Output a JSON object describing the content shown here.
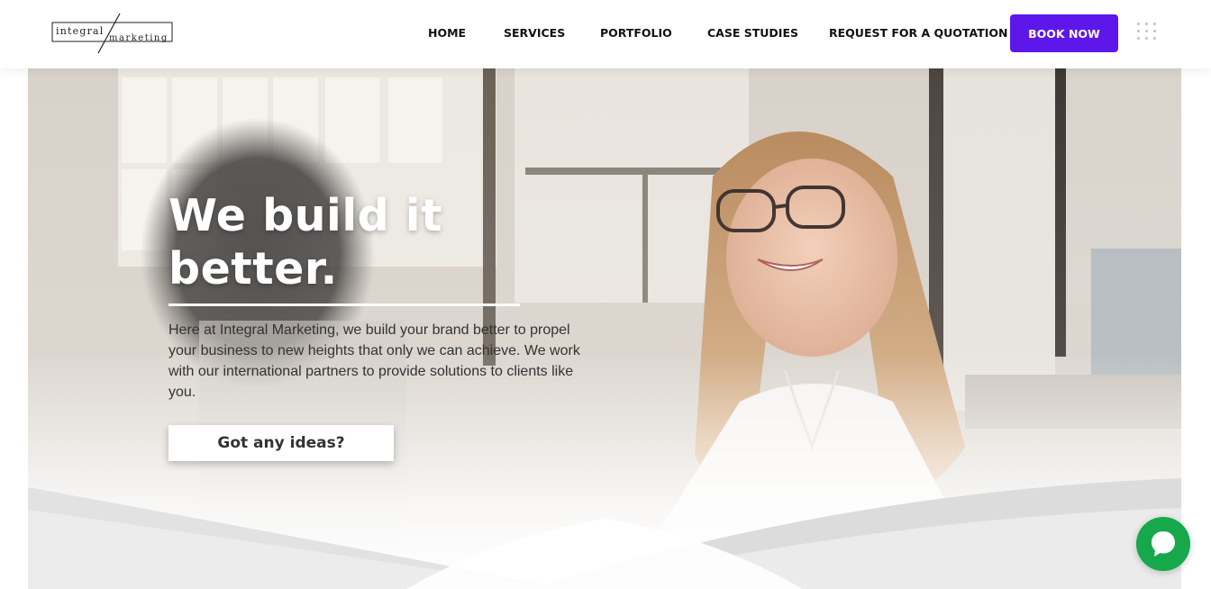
{
  "brand": {
    "logo_word_1": "integral",
    "logo_word_2": "marketing"
  },
  "nav": {
    "items": [
      {
        "label": "HOME"
      },
      {
        "label": "SERVICES"
      },
      {
        "label": "PORTFOLIO"
      },
      {
        "label": "CASE STUDIES"
      },
      {
        "label": "REQUEST FOR A QUOTATION"
      }
    ],
    "book_label": "BOOK NOW",
    "menu_icon": "grid-dots-icon"
  },
  "hero": {
    "title": "We build it better.",
    "description": "Here at Integral Marketing, we build your brand better to propel your business to new heights that only we can achieve. We work with our international partners to provide solutions to clients like you.",
    "cta_label": "Got any ideas?"
  },
  "chat": {
    "icon": "chat-bubble-icon"
  },
  "colors": {
    "accent": "#5e17eb",
    "chat": "#17a84c",
    "text_dark": "#111111"
  }
}
